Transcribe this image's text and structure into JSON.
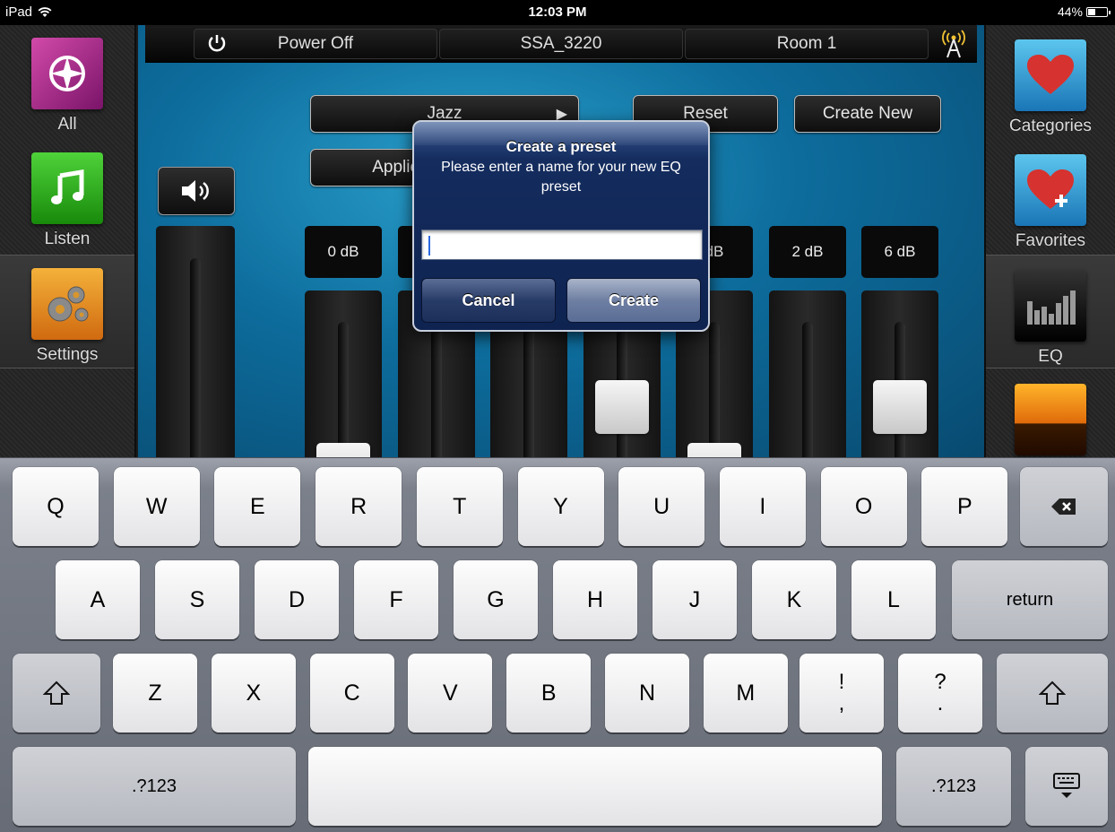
{
  "status_bar": {
    "device": "iPad",
    "time": "12:03 PM",
    "battery": "44%",
    "battery_level": 0.44
  },
  "left_sidebar": {
    "items": [
      {
        "label": "All"
      },
      {
        "label": "Listen"
      },
      {
        "label": "Settings"
      }
    ]
  },
  "right_sidebar": {
    "items": [
      {
        "label": "Categories"
      },
      {
        "label": "Favorites"
      },
      {
        "label": "EQ"
      },
      {
        "label": ""
      }
    ]
  },
  "top_bar": {
    "power_label": "Power Off",
    "device_name": "SSA_3220",
    "room": "Room 1"
  },
  "controls": {
    "preset": "Jazz",
    "reset": "Reset",
    "create_new": "Create New",
    "applied_to": "Applied to: 1 Room"
  },
  "eq_bands": [
    {
      "gain": "0 dB",
      "level": 0.0
    },
    {
      "gain": "",
      "level": -0.3
    },
    {
      "gain": "",
      "level": -0.5
    },
    {
      "gain": "",
      "level": 0.5
    },
    {
      "gain": "dB",
      "level": 0.0
    },
    {
      "gain": "2 dB",
      "level": -0.25
    },
    {
      "gain": "6 dB",
      "level": 0.5
    }
  ],
  "dialog": {
    "title": "Create a preset",
    "message": "Please enter a name for your new EQ preset",
    "input_value": "",
    "cancel_label": "Cancel",
    "create_label": "Create"
  },
  "keyboard": {
    "row1": [
      "Q",
      "W",
      "E",
      "R",
      "T",
      "Y",
      "U",
      "I",
      "O",
      "P"
    ],
    "row2": [
      "A",
      "S",
      "D",
      "F",
      "G",
      "H",
      "J",
      "K",
      "L"
    ],
    "row3": [
      "Z",
      "X",
      "C",
      "V",
      "B",
      "N",
      "M"
    ],
    "punct1": {
      "top": "!",
      "bottom": ","
    },
    "punct2": {
      "top": "?",
      "bottom": "."
    },
    "return_label": "return",
    "numbers_label": ".?123"
  }
}
